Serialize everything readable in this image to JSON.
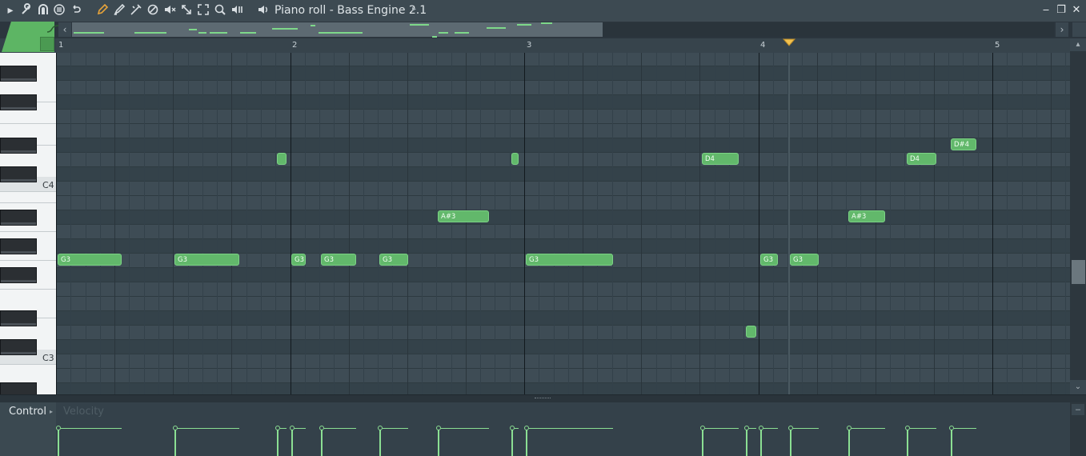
{
  "window": {
    "title": "Piano roll - Bass Engine 2.1",
    "controls": {
      "minimize": "‒",
      "restore": "❐",
      "close": "✕"
    }
  },
  "toolbar": {
    "icons": [
      {
        "name": "options-arrow-icon",
        "glyph": "▸"
      },
      {
        "name": "wrench-icon",
        "glyph": "🔧"
      },
      {
        "name": "magnet-icon",
        "glyph": "∩"
      },
      {
        "name": "playback-icon",
        "glyph": "⊜"
      },
      {
        "name": "undo-icon",
        "glyph": "↶"
      },
      {
        "name": "pencil-icon",
        "glyph": "✎"
      },
      {
        "name": "paint-brush-icon",
        "glyph": "✐"
      },
      {
        "name": "slice-icon",
        "glyph": "✂"
      },
      {
        "name": "delete-icon",
        "glyph": "⊘"
      },
      {
        "name": "mute-icon",
        "glyph": "🔇"
      },
      {
        "name": "slip-icon",
        "glyph": "⇲"
      },
      {
        "name": "select-icon",
        "glyph": "⛶"
      },
      {
        "name": "zoom-icon",
        "glyph": "🔍"
      },
      {
        "name": "playback-tool-icon",
        "glyph": "◧"
      },
      {
        "name": "speaker-icon",
        "glyph": "🔈"
      }
    ],
    "accent_color": "#e8a43a"
  },
  "ruler": {
    "bars": [
      "1",
      "2",
      "3",
      "4",
      "5"
    ]
  },
  "keyboard": {
    "labels": [
      "C4",
      "C3"
    ]
  },
  "notes": [
    {
      "label": "G3"
    },
    {
      "label": "G3"
    },
    {
      "label": "G3"
    },
    {
      "label": "G3"
    },
    {
      "label": "G3"
    },
    {
      "label": "G3"
    },
    {
      "label": "G3"
    },
    {
      "label": "G3"
    },
    {
      "label": "A#3"
    },
    {
      "label": "A#3"
    },
    {
      "label": "D4"
    },
    {
      "label": "D4"
    },
    {
      "label": "D#4"
    },
    {
      "label": ""
    },
    {
      "label": ""
    },
    {
      "label": ""
    }
  ],
  "control": {
    "label": "Control",
    "velocity_label": "Velocity"
  },
  "colors": {
    "note": "#62b86b",
    "velocity": "#8bdf93",
    "background": "#34414a"
  }
}
